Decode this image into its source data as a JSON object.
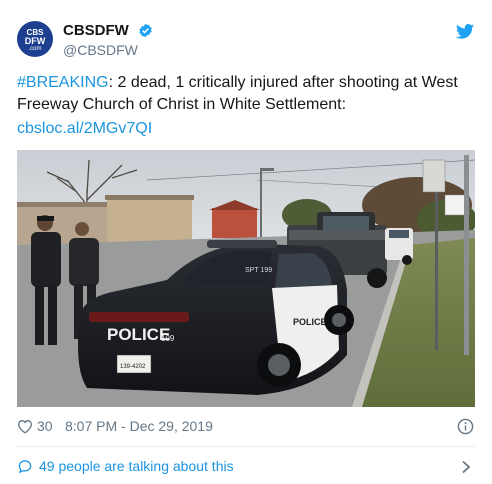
{
  "account": {
    "display_name": "CBSDFW",
    "handle": "@CBSDFW",
    "avatar_text": [
      "CBS",
      "DFW",
      ".com"
    ]
  },
  "tweet": {
    "hashtag": "#BREAKING",
    "text": ": 2 dead, 1 critically injured after shooting at West Freeway Church of Christ in White Settlement:",
    "link": "cbsloc.al/2MGv7QI"
  },
  "photo": {
    "door_text": "POLICE",
    "unit_number": "199",
    "front_text": "SPT 199",
    "plate_text": "139-4202"
  },
  "meta": {
    "likes": "30",
    "timestamp": "8:07 PM - Dec 29, 2019"
  },
  "conversation": {
    "label": "49 people are talking about this"
  },
  "colors": {
    "link": "#1b95e0",
    "verified": "#1da1f2",
    "secondary_text": "#657786"
  },
  "icons": [
    "verified-badge-icon",
    "twitter-bird-icon",
    "heart-icon",
    "info-icon",
    "speech-bubble-icon",
    "chevron-right-icon"
  ]
}
